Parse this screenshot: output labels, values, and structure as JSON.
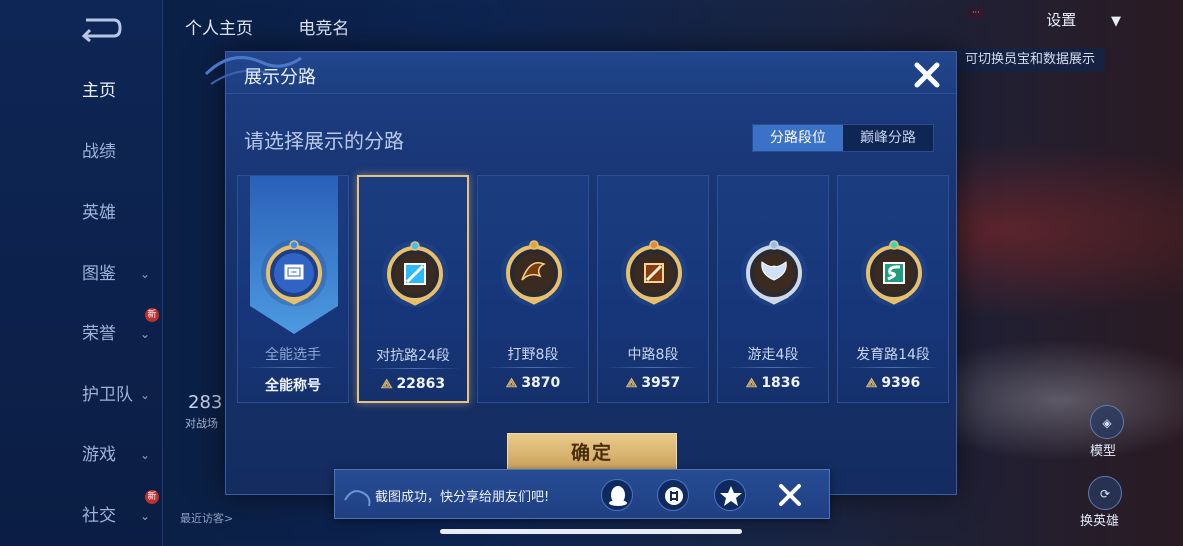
{
  "background": {
    "nav": [
      {
        "label": "主页",
        "active": true,
        "chevron": false,
        "badge": ""
      },
      {
        "label": "战绩",
        "active": false,
        "chevron": false,
        "badge": ""
      },
      {
        "label": "英雄",
        "active": false,
        "chevron": false,
        "badge": ""
      },
      {
        "label": "图鉴",
        "active": false,
        "chevron": true,
        "badge": ""
      },
      {
        "label": "荣誉",
        "active": false,
        "chevron": true,
        "badge": "新"
      },
      {
        "label": "护卫队",
        "active": false,
        "chevron": true,
        "badge": ""
      },
      {
        "label": "游戏",
        "active": false,
        "chevron": true,
        "badge": ""
      },
      {
        "label": "社交",
        "active": false,
        "chevron": true,
        "badge": "新"
      }
    ],
    "tabs": [
      "个人主页",
      "电竞名"
    ],
    "settings_label": "设置",
    "switch_hint": "可切换员宝和数据展示",
    "stat_value": "283",
    "stat_label": "对战场",
    "visitor_label": "最近访客>",
    "right_buttons": [
      "模型",
      "换英雄"
    ]
  },
  "modal": {
    "title": "展示分路",
    "subtitle": "请选择展示的分路",
    "toggle": [
      {
        "label": "分路段位",
        "active": true
      },
      {
        "label": "巅峰分路",
        "active": false
      }
    ],
    "cards": [
      {
        "name": "全能选手",
        "score": "全能称号",
        "emblem": "allround-emblem-icon",
        "selected": false,
        "has_power_icon": false,
        "gem": "#3b8fe6"
      },
      {
        "name": "对抗路24段",
        "score": "22863",
        "emblem": "clash-lane-emblem-icon",
        "selected": true,
        "has_power_icon": true,
        "gem": "#3ec0ff"
      },
      {
        "name": "打野8段",
        "score": "3870",
        "emblem": "jungle-emblem-icon",
        "selected": false,
        "has_power_icon": true,
        "gem": "#e2a440"
      },
      {
        "name": "中路8段",
        "score": "3957",
        "emblem": "mid-lane-emblem-icon",
        "selected": false,
        "has_power_icon": true,
        "gem": "#e28a3a"
      },
      {
        "name": "游走4段",
        "score": "1836",
        "emblem": "roam-emblem-icon",
        "selected": false,
        "has_power_icon": true,
        "gem": "#9fbde0"
      },
      {
        "name": "发育路14段",
        "score": "9396",
        "emblem": "farm-lane-emblem-icon",
        "selected": false,
        "has_power_icon": true,
        "gem": "#3ddab0"
      }
    ],
    "confirm_label": "确定"
  },
  "toast": {
    "message": "截图成功，快分享给朋友们吧!",
    "share_targets": [
      "qq-icon",
      "wechat-icon",
      "qzone-icon"
    ]
  },
  "colors": {
    "accent_gold": "#e6c27e",
    "toggle_active": "#3a72c8",
    "panel": "#17336e"
  }
}
